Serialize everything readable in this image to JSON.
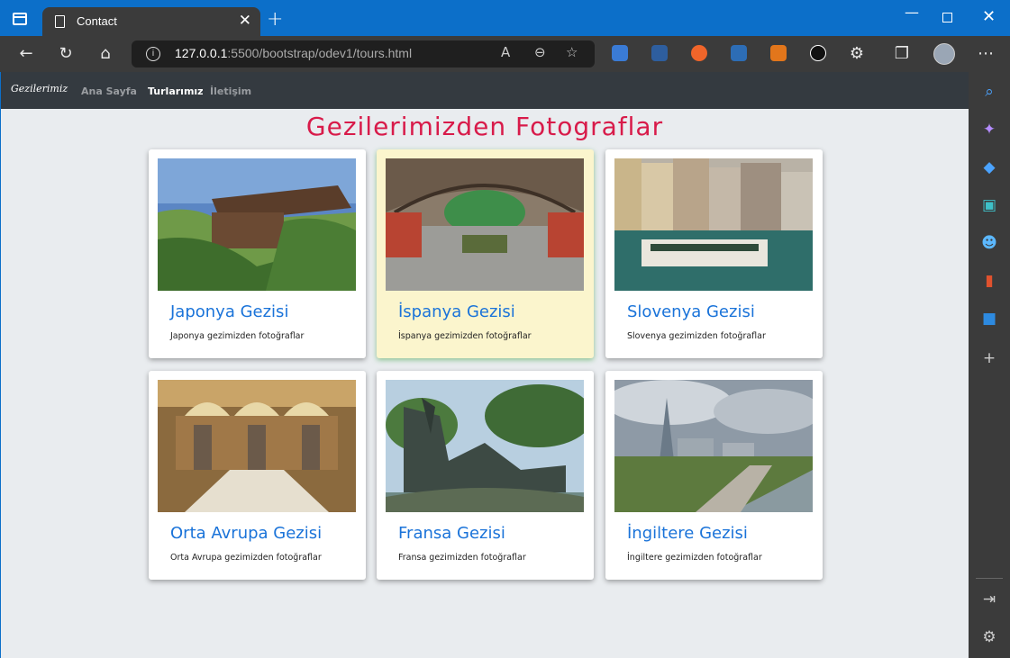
{
  "browser": {
    "tab_title": "Contact",
    "tab_close": "✕",
    "new_tab": "+",
    "address_host": "127.0.0.1",
    "address_path": ":5500/bootstrap/odev1/tours.html",
    "info_glyph": "i"
  },
  "site": {
    "brand": "Gezilerimiz",
    "nav": [
      {
        "label": "Ana Sayfa",
        "active": false
      },
      {
        "label": "Turlarımız",
        "active": true
      },
      {
        "label": "İletişim",
        "active": false
      }
    ],
    "heading": "Gezilerimizden Fotograflar"
  },
  "cards": [
    {
      "title": "Japonya Gezisi",
      "text": "Japonya gezimizden fotoğraflar",
      "image": "japan-temple-image"
    },
    {
      "title": "İspanya Gezisi",
      "text": "İspanya gezimizden fotoğraflar",
      "image": "spain-station-image"
    },
    {
      "title": "Slovenya Gezisi",
      "text": "Slovenya gezimizden fotoğraflar",
      "image": "slovenia-river-image"
    },
    {
      "title": "Orta Avrupa Gezisi",
      "text": "Orta Avrupa gezimizden fotoğraflar",
      "image": "central-europe-hall-image"
    },
    {
      "title": "Fransa Gezisi",
      "text": "Fransa gezimizden fotoğraflar",
      "image": "france-fountain-image"
    },
    {
      "title": "İngiltere Gezisi",
      "text": "İngiltere gezimizden fotoğraflar",
      "image": "england-thames-image"
    }
  ],
  "colors": {
    "heading": "#d81b4a",
    "card_title": "#1a73d9",
    "navbar": "#343a40",
    "highlight_card": "#fbf5cd"
  }
}
